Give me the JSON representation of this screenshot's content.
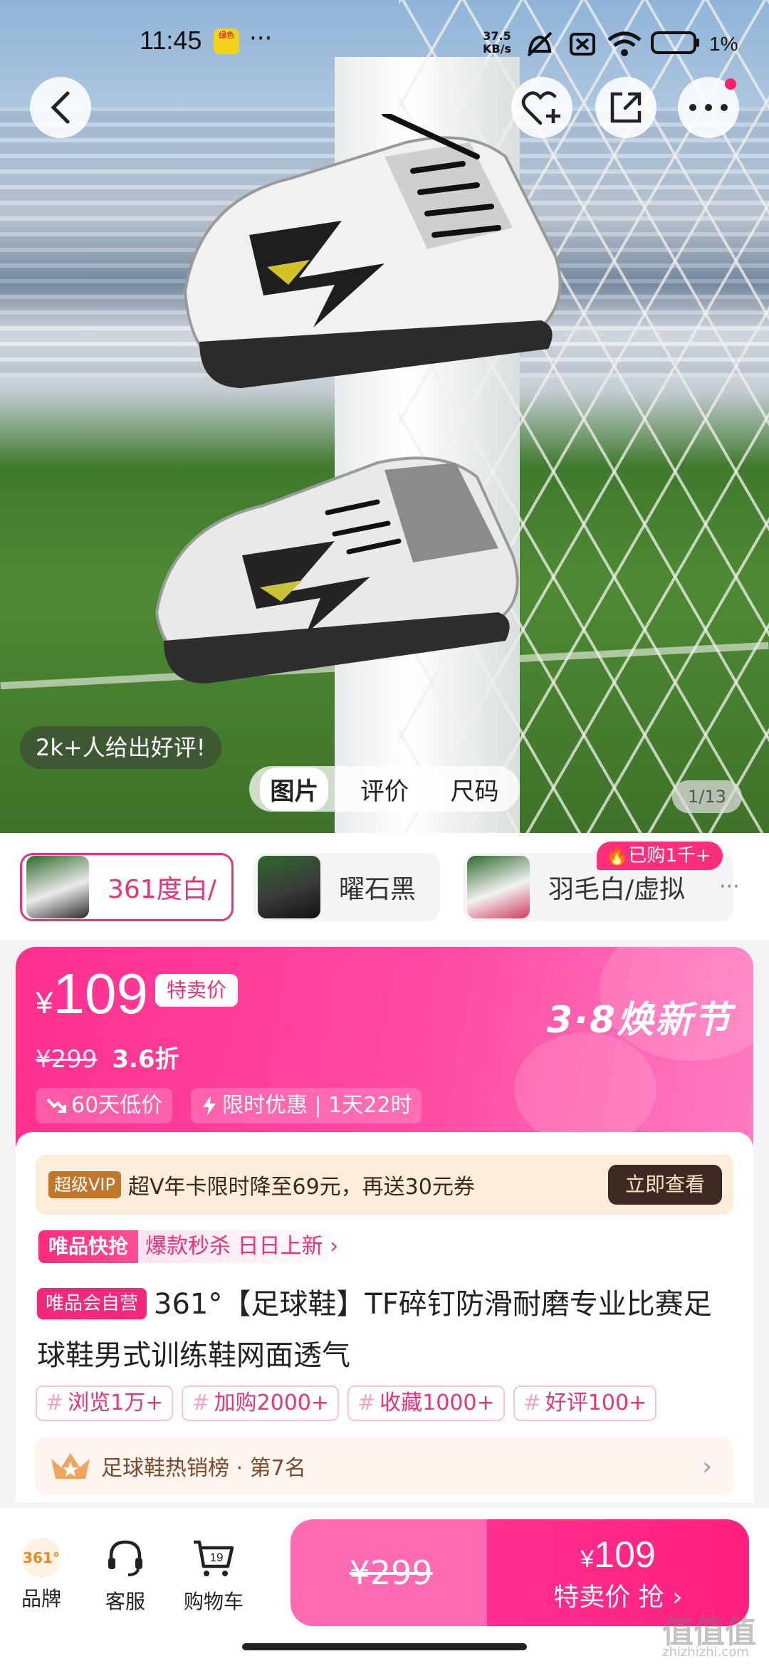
{
  "status_bar": {
    "time": "11:45",
    "app_badge": "绿色",
    "more": "···",
    "net_speed_value": "37.5",
    "net_speed_unit": "KB/s",
    "battery": "1%"
  },
  "hero": {
    "review_pill": "2k+人给出好评!",
    "tabs": [
      "图片",
      "评价",
      "尺码"
    ],
    "active_tab": "图片",
    "counter": "1/13"
  },
  "variants": {
    "items": [
      {
        "label": "361度白/"
      },
      {
        "label": "曜石黑"
      },
      {
        "label": "羽毛白/虚拟"
      }
    ],
    "selected_index": 0,
    "bought_badge": "已购1千+",
    "more": "···"
  },
  "price": {
    "currency": "¥",
    "amount": "109",
    "tag": "特卖价",
    "original": "¥299",
    "discount": "3.6折",
    "chip_low": "60天低价",
    "chip_limited": "限时优惠 | 1天22时",
    "festival": "3·8焕新节"
  },
  "vip": {
    "tag": "超级VIP",
    "text": "超V年卡限时降至69元，再送30元券",
    "button": "立即查看"
  },
  "flash": {
    "tag": "唯品快抢",
    "text": "爆款秒杀 日日上新 ›"
  },
  "product": {
    "self_tag": "唯品会自营",
    "title": "361°【足球鞋】TF碎钉防滑耐磨专业比赛足球鞋男式训练鞋网面透气"
  },
  "stats": [
    "浏览1万+",
    "加购2000+",
    "收藏1000+",
    "好评100+"
  ],
  "rank": {
    "text": "足球鞋热销榜 · 第7名"
  },
  "bottom": {
    "brand": "品牌",
    "brand_logo": "361°",
    "service": "客服",
    "cart": "购物车",
    "cart_count": "19",
    "left_price": "¥299",
    "right_currency": "¥",
    "right_price": "109",
    "right_action": "特卖价 抢 ›"
  },
  "watermark": {
    "main": "值值值",
    "sub": "zhizhizhi.com"
  },
  "colors": {
    "accent": "#e8337a",
    "price_bg": "#ff2f8f",
    "vip_bg": "#fbedd9"
  }
}
